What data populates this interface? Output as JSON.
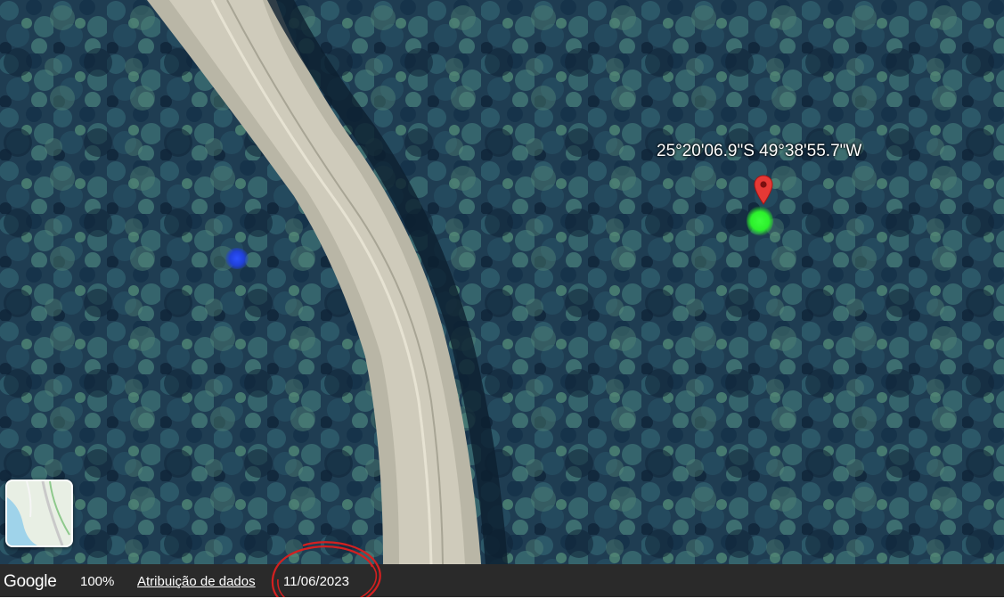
{
  "map": {
    "coordinates_label": "25°20'06.9\"S 49°38'55.7\"W",
    "marker_icon": "map-pin-icon",
    "marker_color": "#e53935"
  },
  "footer": {
    "logo_text": "Google",
    "zoom_level": "100%",
    "attribution_link": "Atribuição de dados",
    "imagery_date": "11/06/2023"
  },
  "annotation": {
    "circle_color": "#d42020"
  }
}
